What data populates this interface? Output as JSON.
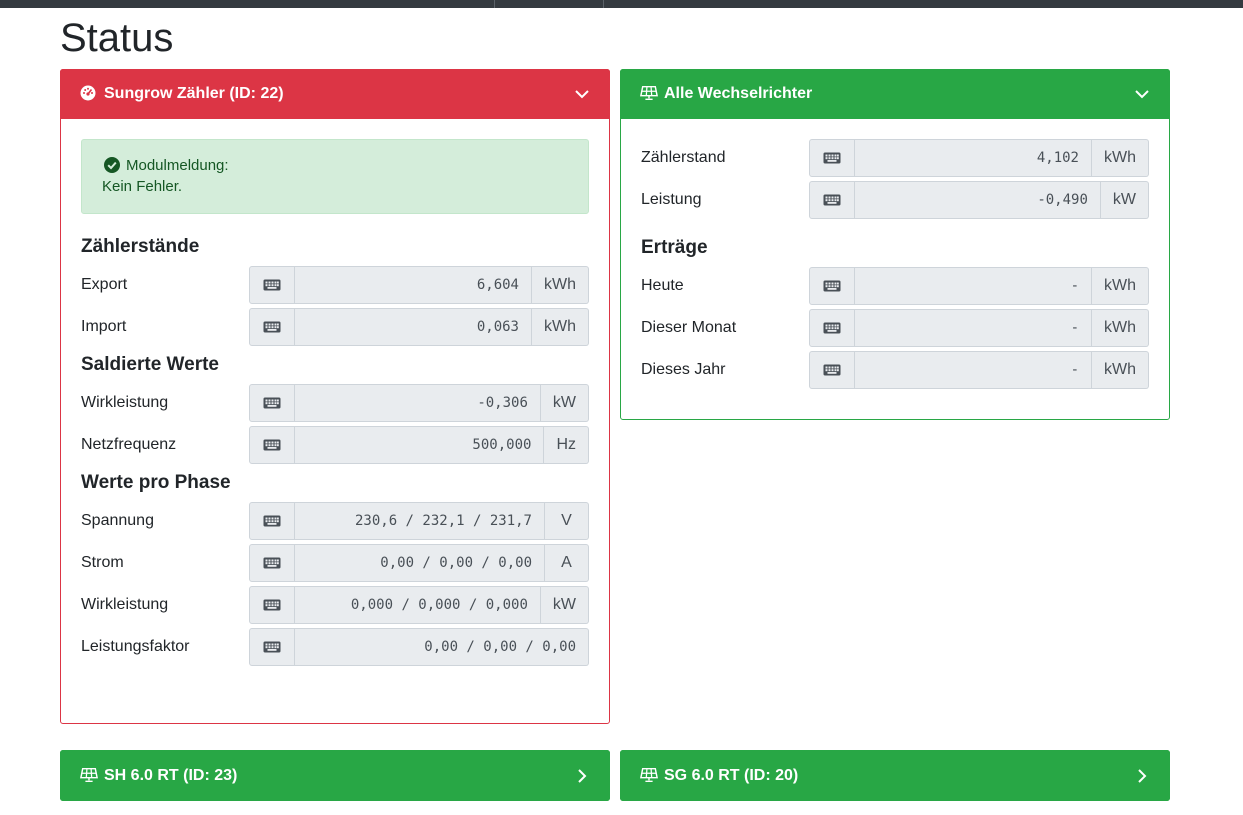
{
  "page": {
    "title": "Status"
  },
  "colors": {
    "danger": "#dc3545",
    "success": "#28a745",
    "alert_bg": "#d4edda",
    "alert_text": "#155724"
  },
  "meter_card": {
    "title": "Sungrow Zähler (ID: 22)",
    "icon": "gauge-icon",
    "alert": {
      "heading": "Modulmeldung:",
      "message": "Kein Fehler."
    },
    "sections": [
      {
        "title": "Zählerstände",
        "rows": [
          {
            "label": "Export",
            "value": "6,604",
            "unit": "kWh"
          },
          {
            "label": "Import",
            "value": "0,063",
            "unit": "kWh"
          }
        ]
      },
      {
        "title": "Saldierte Werte",
        "rows": [
          {
            "label": "Wirkleistung",
            "value": "-0,306",
            "unit": "kW"
          },
          {
            "label": "Netzfrequenz",
            "value": "500,000",
            "unit": "Hz"
          }
        ]
      },
      {
        "title": "Werte pro Phase",
        "rows": [
          {
            "label": "Spannung",
            "value": "230,6 / 232,1 / 231,7",
            "unit": "V"
          },
          {
            "label": "Strom",
            "value": "0,00 / 0,00 / 0,00",
            "unit": "A"
          },
          {
            "label": "Wirkleistung",
            "value": "0,000 / 0,000 / 0,000",
            "unit": "kW"
          },
          {
            "label": "Leistungsfaktor",
            "value": "0,00 / 0,00 / 0,00",
            "unit": ""
          }
        ]
      }
    ]
  },
  "inverter_card": {
    "title": "Alle Wechselrichter",
    "icon": "solar-panel-icon",
    "rows": [
      {
        "label": "Zählerstand",
        "value": "4,102",
        "unit": "kWh"
      },
      {
        "label": "Leistung",
        "value": "-0,490",
        "unit": "kW"
      }
    ],
    "section_title": "Erträge",
    "yield_rows": [
      {
        "label": "Heute",
        "value": "-",
        "unit": "kWh"
      },
      {
        "label": "Dieser Monat",
        "value": "-",
        "unit": "kWh"
      },
      {
        "label": "Dieses Jahr",
        "value": "-",
        "unit": "kWh"
      }
    ]
  },
  "collapsed_cards": [
    {
      "title": "SH 6.0 RT (ID: 23)",
      "icon": "solar-panel-icon"
    },
    {
      "title": "SG 6.0 RT (ID: 20)",
      "icon": "solar-panel-icon"
    }
  ]
}
